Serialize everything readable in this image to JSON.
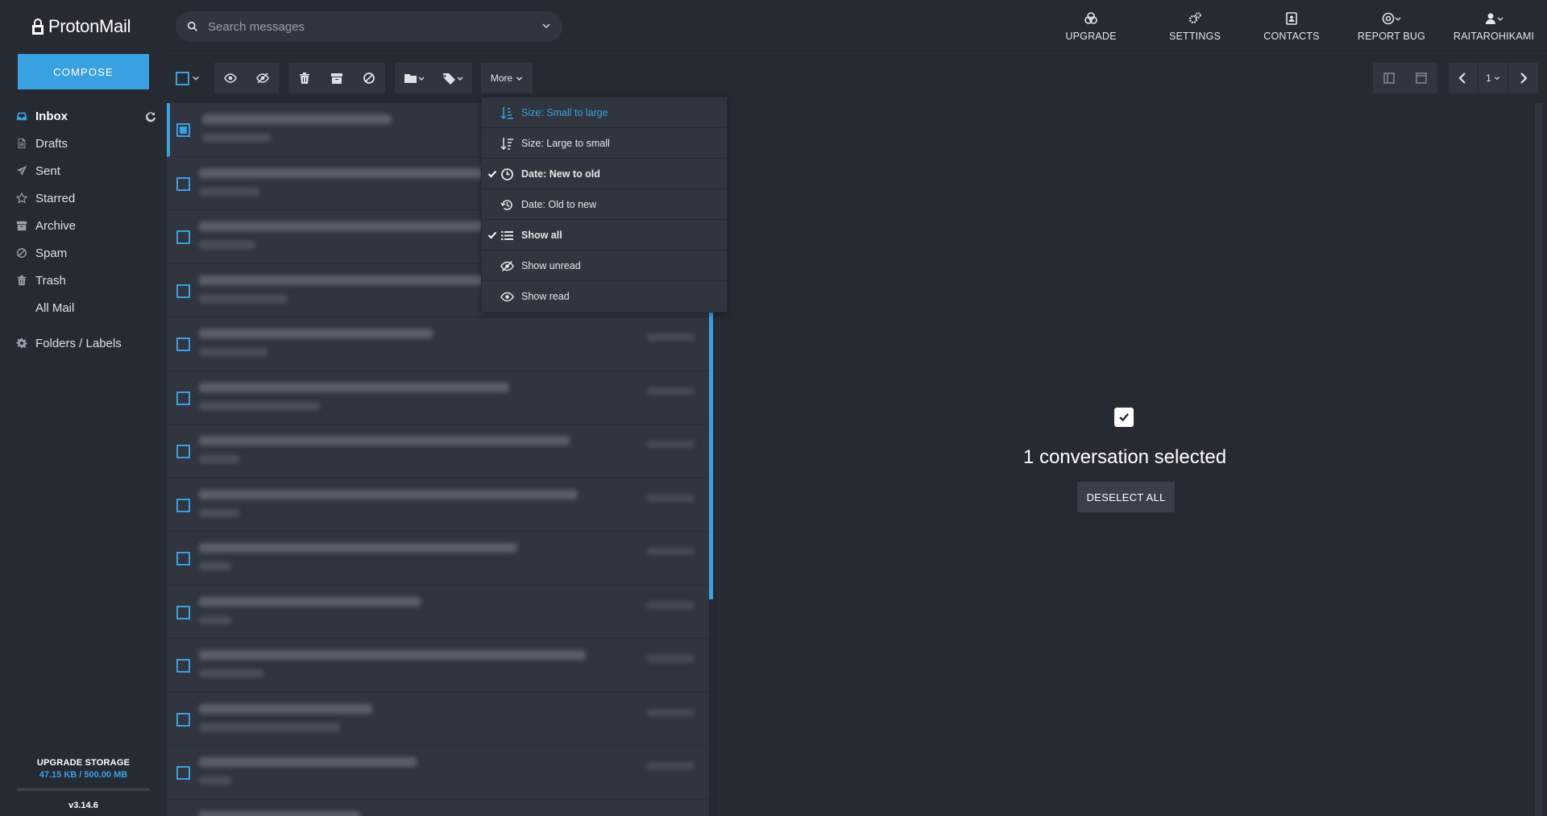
{
  "app": {
    "logo_text": "ProtonMail",
    "compose_label": "COMPOSE",
    "accent_color": "#3aa1e0"
  },
  "sidebar": {
    "items": [
      {
        "label": "Inbox",
        "icon": "inbox-icon",
        "active": true
      },
      {
        "label": "Drafts",
        "icon": "drafts-icon"
      },
      {
        "label": "Sent",
        "icon": "sent-icon"
      },
      {
        "label": "Starred",
        "icon": "star-icon"
      },
      {
        "label": "Archive",
        "icon": "archive-icon"
      },
      {
        "label": "Spam",
        "icon": "spam-icon"
      },
      {
        "label": "Trash",
        "icon": "trash-icon"
      },
      {
        "label": "All Mail",
        "icon": ""
      },
      {
        "label": "Folders / Labels",
        "icon": "gear-icon"
      }
    ],
    "storage_title": "UPGRADE STORAGE",
    "storage_usage": "47.15 KB / 500.00 MB",
    "version": "v3.14.6"
  },
  "search": {
    "placeholder": "Search messages"
  },
  "topnav": {
    "upgrade": "UPGRADE",
    "settings": "SETTINGS",
    "contacts": "CONTACTS",
    "report_bug": "REPORT BUG",
    "user": "RAITAROHIKAMI"
  },
  "toolbar": {
    "more_label": "More",
    "page_number": "1"
  },
  "more_menu": {
    "items": [
      {
        "label": "Size: Small to large",
        "icon": "sort-size-asc-icon",
        "checked": false,
        "highlighted": true
      },
      {
        "label": "Size: Large to small",
        "icon": "sort-size-desc-icon",
        "checked": false
      },
      {
        "label": "Date: New to old",
        "icon": "clock-icon",
        "checked": true
      },
      {
        "label": "Date: Old to new",
        "icon": "history-icon",
        "checked": false
      },
      {
        "label": "Show all",
        "icon": "list-icon",
        "checked": true
      },
      {
        "label": "Show unread",
        "icon": "eye-slash-icon",
        "checked": false
      },
      {
        "label": "Show read",
        "icon": "eye-icon",
        "checked": false
      }
    ]
  },
  "reader": {
    "selection_text": "1 conversation selected",
    "deselect_label": "DESELECT ALL"
  }
}
